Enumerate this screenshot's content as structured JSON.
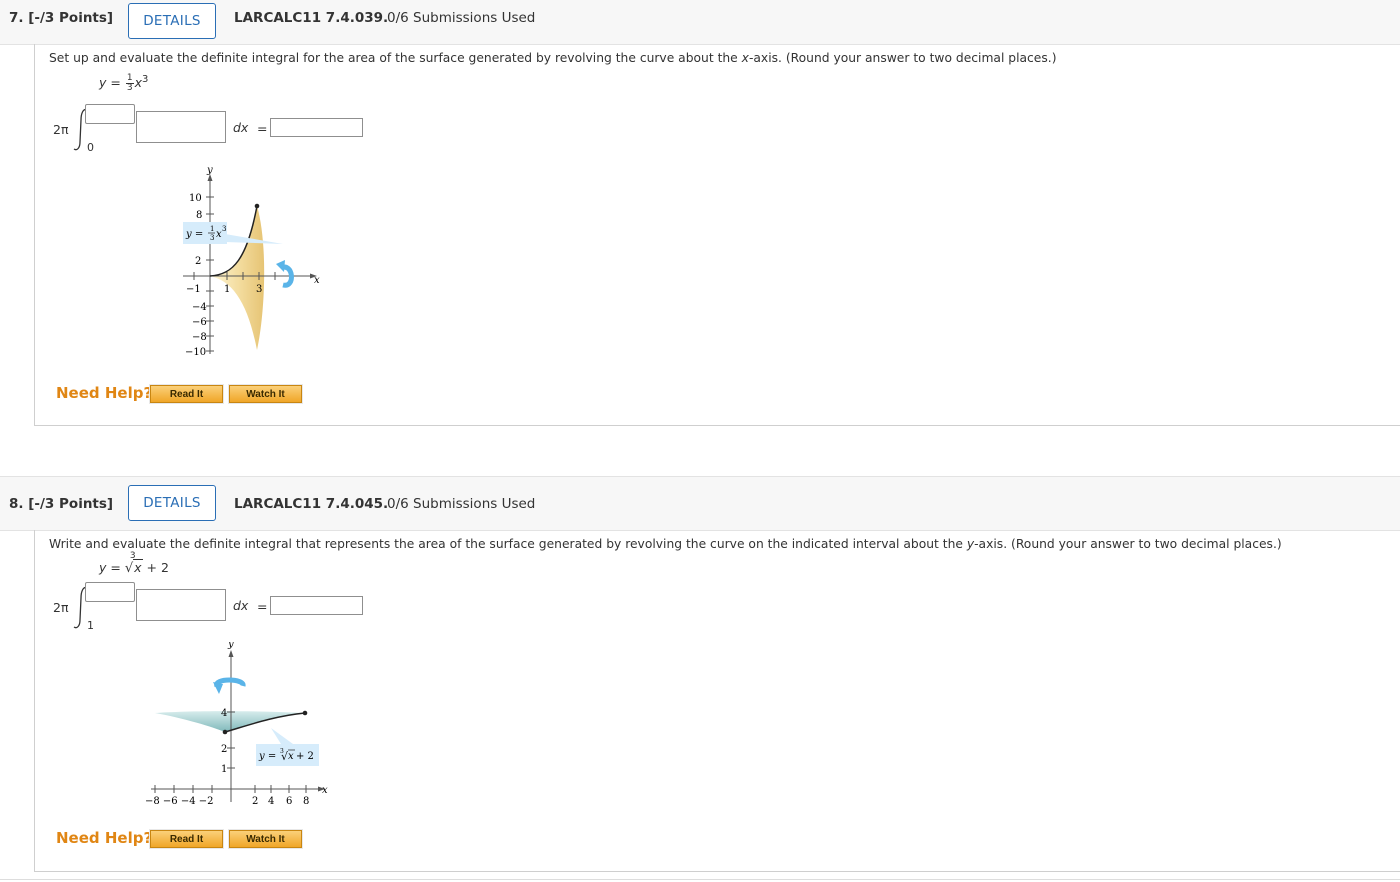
{
  "q7": {
    "number": "7. [-/3 Points]",
    "details_label": "DETAILS",
    "code": "LARCALC11 7.4.039.",
    "submissions": "0/6 Submissions Used",
    "prompt_pre": "Set up and evaluate the definite integral for the area of the surface generated by revolving the curve about the ",
    "prompt_var": "x",
    "prompt_post": "-axis. (Round your answer to two decimal places.)",
    "equation": {
      "lhs": "y =",
      "frac_num": "1",
      "frac_den": "3",
      "rest": "x",
      "exp": "3"
    },
    "integral": {
      "coef": "2π",
      "lower": "0",
      "dx": "dx",
      "eq": "="
    },
    "figure": {
      "y_axis_label": "y",
      "x_axis_label": "x",
      "y_ticks": [
        "10",
        "8",
        "2",
        "−4",
        "−6",
        "−8",
        "−10"
      ],
      "x_ticks": [
        "−1",
        "1",
        "3"
      ],
      "curve_label": {
        "lhs": "y =",
        "num": "1",
        "den": "3",
        "var": "x",
        "exp": "3"
      }
    },
    "need_help": "Need Help?",
    "read_it": "Read It",
    "watch_it": "Watch It"
  },
  "q8": {
    "number": "8. [-/3 Points]",
    "details_label": "DETAILS",
    "code": "LARCALC11 7.4.045.",
    "submissions": "0/6 Submissions Used",
    "prompt_pre": "Write and evaluate the definite integral that represents the area of the surface generated by revolving the curve on the indicated interval about the ",
    "prompt_var": "y",
    "prompt_post": "-axis. (Round your answer to two decimal places.)",
    "equation": {
      "lhs": "y =",
      "root_index": "3",
      "radicand": "x",
      "rest": "+ 2"
    },
    "integral": {
      "coef": "2π",
      "lower": "1",
      "dx": "dx",
      "eq": "="
    },
    "figure": {
      "y_axis_label": "y",
      "x_axis_label": "x",
      "y_ticks": [
        "4",
        "2",
        "1"
      ],
      "x_ticks_neg": "−8 −6 −4 −2",
      "x_ticks_pos": [
        "2",
        "4",
        "6",
        "8"
      ],
      "curve_label": {
        "lhs": "y =",
        "root_index": "3",
        "radicand": "x",
        "rest": "+ 2"
      }
    },
    "need_help": "Need Help?",
    "read_it": "Read It",
    "watch_it": "Watch It"
  },
  "colors": {
    "link_blue": "#2a6eb5",
    "help_orange": "#e08614",
    "button_orange": "#f0a628",
    "callout_blue": "#d6ecfb",
    "surface_gold": "#f3dc9e",
    "surface_teal": "#8fc4c5",
    "rotate_arrow": "#5ab4e8"
  }
}
